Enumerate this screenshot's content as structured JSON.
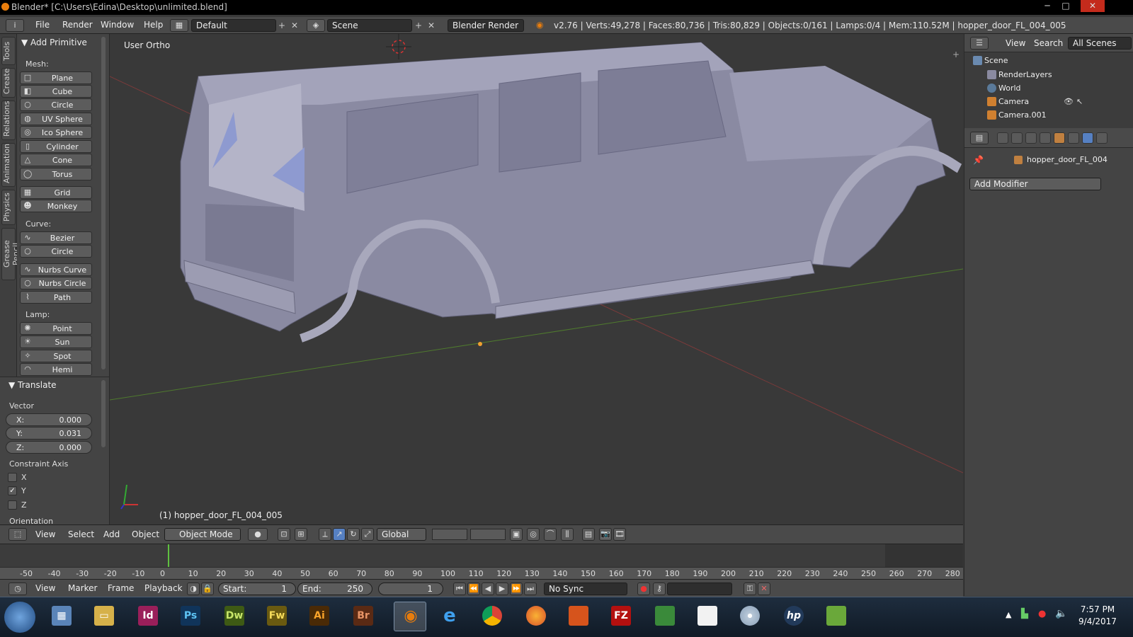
{
  "window": {
    "title": "Blender* [C:\\Users\\Edina\\Desktop\\unlimited.blend]",
    "min": "─",
    "max": "□",
    "close": "✕"
  },
  "menubar": {
    "info_icon": "i",
    "items": [
      "File",
      "Render",
      "Window",
      "Help"
    ],
    "screen_layout": "Default",
    "scene": "Scene",
    "render_engine": "Blender Render",
    "stats": "v2.76 | Verts:49,278 | Faces:80,736 | Tris:80,829 | Objects:0/161 | Lamps:0/4 | Mem:110.52M | hopper_door_FL_004_005"
  },
  "tool_tabs": [
    "Tools",
    "Create",
    "Relations",
    "Animation",
    "Physics",
    "Grease Pencil"
  ],
  "tool_shelf": {
    "panel_title": "Add Primitive",
    "mesh_label": "Mesh:",
    "mesh": [
      "Plane",
      "Cube",
      "Circle",
      "UV Sphere",
      "Ico Sphere",
      "Cylinder",
      "Cone",
      "Torus",
      "Grid",
      "Monkey"
    ],
    "curve_label": "Curve:",
    "curve": [
      "Bezier",
      "Circle",
      "Nurbs Curve",
      "Nurbs Circle",
      "Path"
    ],
    "lamp_label": "Lamp:",
    "lamp": [
      "Point",
      "Sun",
      "Spot",
      "Hemi"
    ]
  },
  "operator_panel": {
    "title": "Translate",
    "vector_label": "Vector",
    "x_label": "X:",
    "x_value": "0.000",
    "y_label": "Y:",
    "y_value": "0.031",
    "z_label": "Z:",
    "z_value": "0.000",
    "constraint_label": "Constraint Axis",
    "axes": [
      {
        "label": "X",
        "checked": false
      },
      {
        "label": "Y",
        "checked": true
      },
      {
        "label": "Z",
        "checked": false
      }
    ],
    "orientation_label": "Orientation"
  },
  "viewport": {
    "view_label": "User Ortho",
    "active_object": "(1) hopper_door_FL_004_005"
  },
  "viewport_header": {
    "menus": [
      "View",
      "Select",
      "Add",
      "Object"
    ],
    "mode": "Object Mode",
    "orientation": "Global"
  },
  "timeline": {
    "ticks": [
      "-50",
      "-40",
      "-30",
      "-20",
      "-10",
      "0",
      "10",
      "20",
      "30",
      "40",
      "50",
      "60",
      "70",
      "80",
      "90",
      "100",
      "110",
      "120",
      "130",
      "140",
      "150",
      "160",
      "170",
      "180",
      "190",
      "200",
      "210",
      "220",
      "230",
      "240",
      "250",
      "260",
      "270",
      "280"
    ],
    "current_frame_marker": "0"
  },
  "timeline_header": {
    "menus": [
      "View",
      "Marker",
      "Frame",
      "Playback"
    ],
    "start_label": "Start:",
    "start_value": "1",
    "end_label": "End:",
    "end_value": "250",
    "current_frame": "1",
    "sync": "No Sync"
  },
  "outliner": {
    "menus": [
      "View",
      "Search"
    ],
    "filter": "All Scenes",
    "items": [
      {
        "label": "Scene",
        "icon": "scene-icon",
        "indent": 0
      },
      {
        "label": "RenderLayers",
        "icon": "renderlayers-icon",
        "indent": 1
      },
      {
        "label": "World",
        "icon": "world-icon",
        "indent": 1
      },
      {
        "label": "Camera",
        "icon": "camera-icon",
        "indent": 0
      },
      {
        "label": "Camera.001",
        "icon": "camera-icon",
        "indent": 0
      }
    ]
  },
  "properties": {
    "object_name": "hopper_door_FL_004",
    "add_modifier": "Add Modifier"
  },
  "taskbar": {
    "apps": [
      {
        "name": "start-button",
        "label": ""
      },
      {
        "name": "calculator",
        "label": ""
      },
      {
        "name": "explorer",
        "label": ""
      },
      {
        "name": "indesign",
        "label": "Id"
      },
      {
        "name": "photoshop",
        "label": "Ps"
      },
      {
        "name": "dreamweaver",
        "label": "Dw"
      },
      {
        "name": "fireworks",
        "label": "Fw"
      },
      {
        "name": "illustrator",
        "label": "Ai"
      },
      {
        "name": "bridge",
        "label": "Br"
      },
      {
        "name": "blender",
        "label": ""
      },
      {
        "name": "internet-explorer",
        "label": "e"
      },
      {
        "name": "chrome",
        "label": ""
      },
      {
        "name": "firefox",
        "label": ""
      },
      {
        "name": "office",
        "label": ""
      },
      {
        "name": "filezilla",
        "label": "FZ"
      },
      {
        "name": "app-green",
        "label": ""
      },
      {
        "name": "notepad",
        "label": ""
      },
      {
        "name": "disc",
        "label": ""
      },
      {
        "name": "hp",
        "label": "hp"
      },
      {
        "name": "chart-app",
        "label": ""
      }
    ],
    "time": "7:57 PM",
    "date": "9/4/2017"
  }
}
